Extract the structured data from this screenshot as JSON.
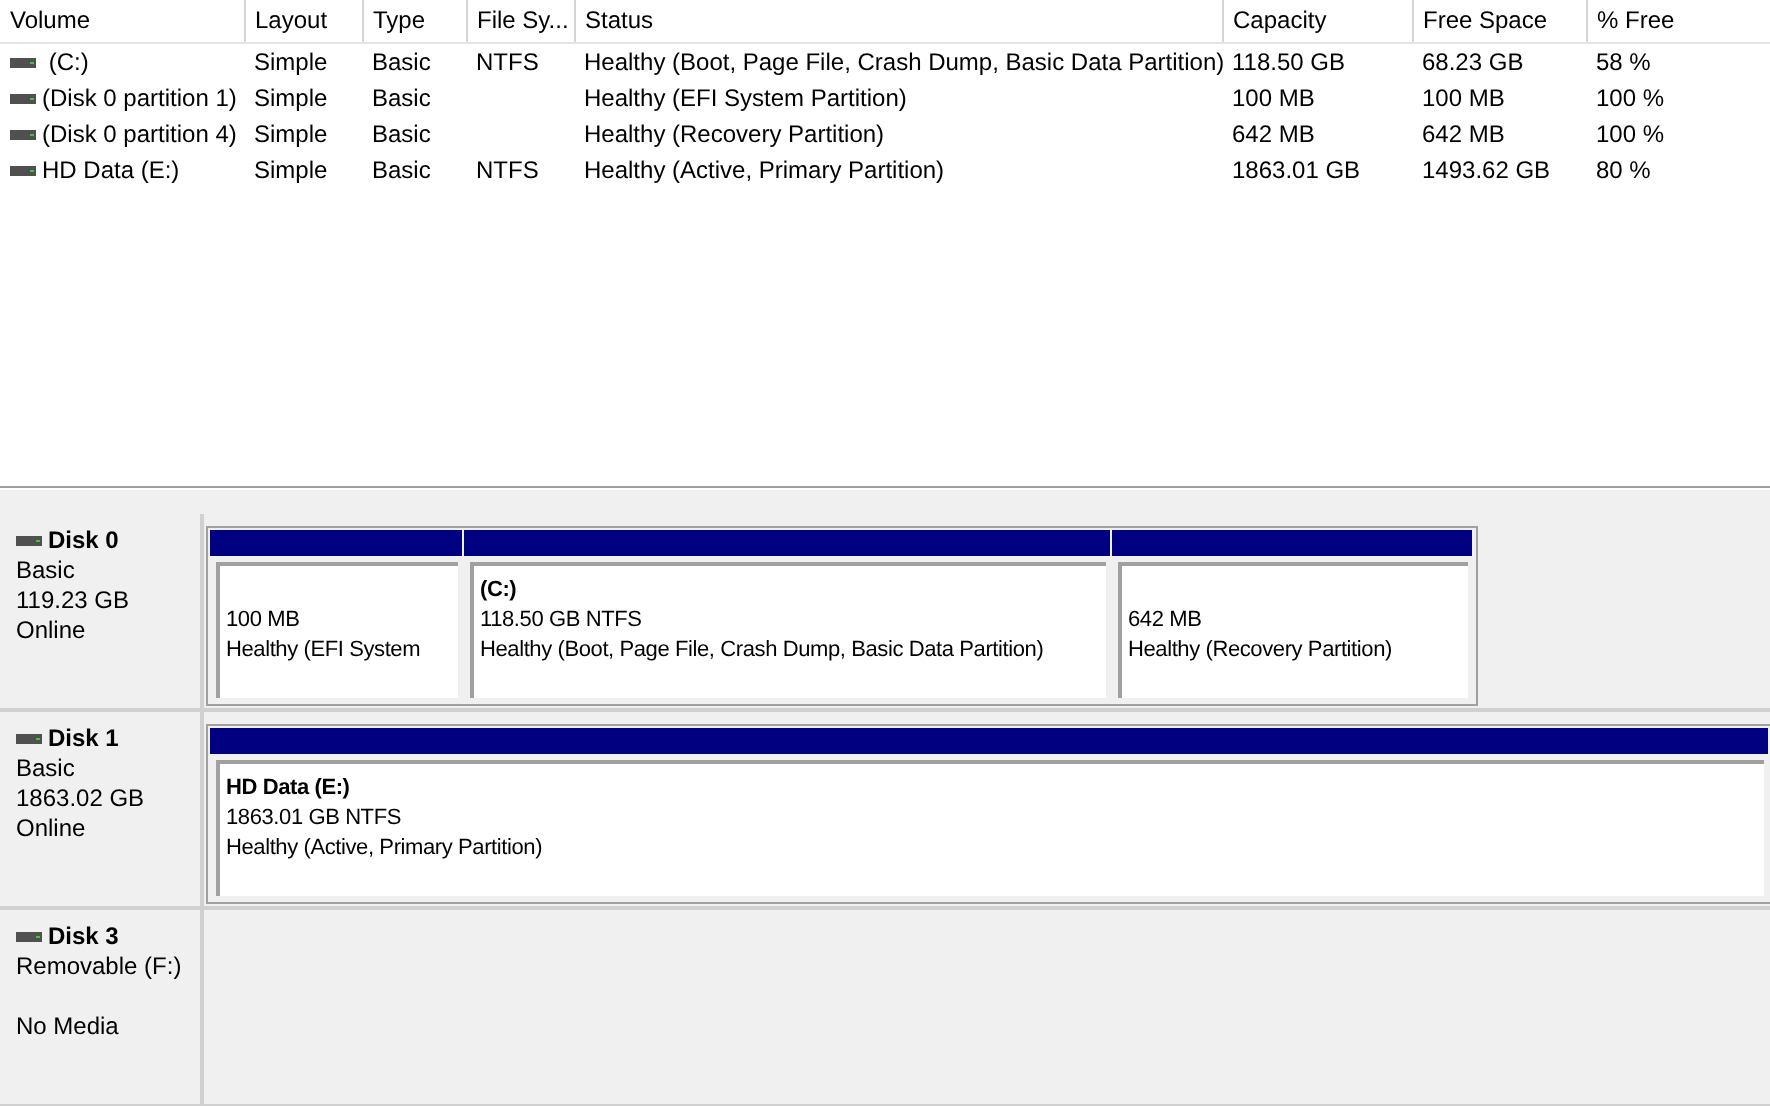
{
  "volume_table": {
    "columns": [
      "Volume",
      "Layout",
      "Type",
      "File Sy...",
      "Status",
      "Capacity",
      "Free Space",
      "% Free"
    ],
    "rows": [
      {
        "cells": [
          " (C:)",
          "Simple",
          "Basic",
          "NTFS",
          "Healthy (Boot, Page File, Crash Dump, Basic Data Partition)",
          "118.50 GB",
          "68.23 GB",
          "58 %"
        ]
      },
      {
        "cells": [
          "(Disk 0 partition 1)",
          "Simple",
          "Basic",
          "",
          "Healthy (EFI System Partition)",
          "100 MB",
          "100 MB",
          "100 %"
        ]
      },
      {
        "cells": [
          "(Disk 0 partition 4)",
          "Simple",
          "Basic",
          "",
          "Healthy (Recovery Partition)",
          "642 MB",
          "642 MB",
          "100 %"
        ]
      },
      {
        "cells": [
          "HD Data (E:)",
          "Simple",
          "Basic",
          "NTFS",
          "Healthy (Active, Primary Partition)",
          "1863.01 GB",
          "1493.62 GB",
          "80 %"
        ]
      }
    ]
  },
  "disks": [
    {
      "name": "Disk 0",
      "lines": [
        "Basic",
        "119.23 GB"
      ],
      "status": "Online",
      "partitions": [
        {
          "lines": [
            "100 MB",
            "Healthy (EFI System"
          ]
        },
        {
          "title": "(C:)",
          "lines": [
            "118.50 GB NTFS",
            "Healthy (Boot, Page File, Crash Dump, Basic Data Partition)"
          ]
        },
        {
          "lines": [
            "642 MB",
            "Healthy (Recovery Partition)"
          ]
        }
      ]
    },
    {
      "name": "Disk 1",
      "lines": [
        "Basic",
        "1863.02 GB"
      ],
      "status": "Online",
      "partitions": [
        {
          "title": "HD Data  (E:)",
          "lines": [
            "1863.01 GB NTFS",
            "Healthy (Active, Primary Partition)"
          ]
        }
      ]
    },
    {
      "name": "Disk 3",
      "lines": [
        "Removable (F:)"
      ],
      "status": "No Media"
    }
  ]
}
